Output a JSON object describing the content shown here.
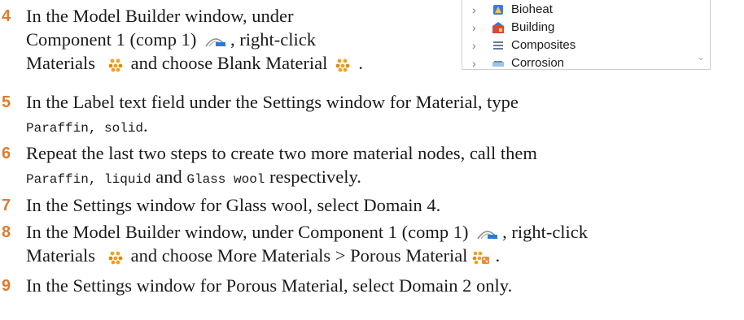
{
  "tree": {
    "items": [
      {
        "label": "Bioheat",
        "icon": "bioheat-icon"
      },
      {
        "label": "Building",
        "icon": "building-icon"
      },
      {
        "label": "Composites",
        "icon": "composites-icon"
      },
      {
        "label": "Corrosion",
        "icon": "corrosion-icon"
      }
    ]
  },
  "steps": [
    {
      "num": "4",
      "line1": "In the Model Builder window, under",
      "line2a": "Component 1 (comp 1)",
      "line2b": ", right-click",
      "line3a": "Materials",
      "line3b": "and choose Blank Material",
      "line3c": "."
    },
    {
      "num": "5",
      "line1": "In the Label text field under the Settings window for Material, type",
      "code1": "Paraffin, solid",
      "line2b": "."
    },
    {
      "num": "6",
      "line1": "Repeat the last two steps to create two more material nodes, call them",
      "code1": "Paraffin, liquid",
      "mid": " and ",
      "code2": "Glass wool",
      "end": " respectively."
    },
    {
      "num": "7",
      "line1": "In the Settings window for Glass wool, select Domain 4."
    },
    {
      "num": "8",
      "line1a": "In the Model Builder window, under Component 1 (comp 1)",
      "line1b": ", right-click",
      "line2a": "Materials",
      "line2b": "and choose More Materials > Porous Material",
      "line2c": "."
    },
    {
      "num": "9",
      "line1": "In the Settings window for Porous Material, select Domain 2 only."
    }
  ],
  "colors": {
    "step_number": "#e07a2e",
    "component_icon_blue": "#2a7bd6",
    "material_icon_orange": "#f0a020"
  }
}
